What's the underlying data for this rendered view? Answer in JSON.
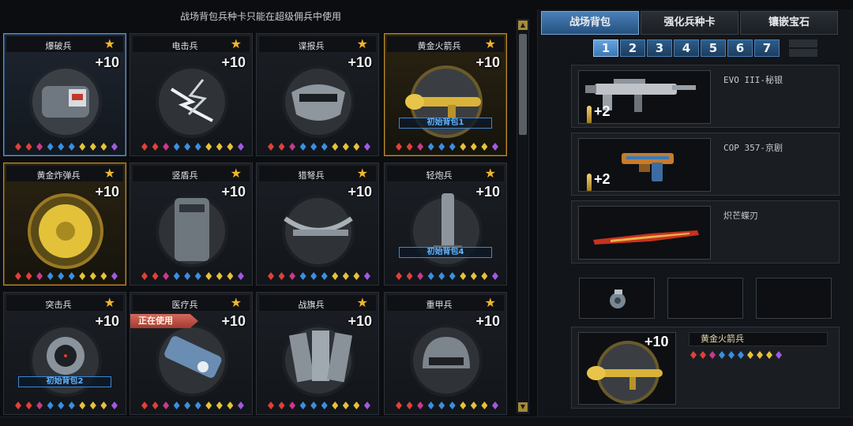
{
  "notice": "战场背包兵种卡只能在超级佣兵中使用",
  "colors": {
    "gold": "#f2b62e",
    "blue_badge": "#5fb2ff",
    "active_tab": "#4a7fb8",
    "inuse_red": "#c24a3c"
  },
  "gem_colors": [
    "#e0403a",
    "#e0403a",
    "#c83a8a",
    "#3a8fe0",
    "#3a8fe0",
    "#3a8fe0",
    "#e6c23a",
    "#e6c23a",
    "#e6c23a",
    "#a05ae0"
  ],
  "cards": [
    {
      "name": "爆破兵",
      "plus": "+10",
      "icon": "explosive-pack-icon",
      "state": "selected",
      "badge": "",
      "inuse": ""
    },
    {
      "name": "电击兵",
      "plus": "+10",
      "icon": "lightning-icon",
      "state": "",
      "badge": "",
      "inuse": ""
    },
    {
      "name": "谍报兵",
      "plus": "+10",
      "icon": "spy-mask-icon",
      "state": "",
      "badge": "",
      "inuse": ""
    },
    {
      "name": "黄金火箭兵",
      "plus": "+10",
      "icon": "rocket-launcher-icon",
      "state": "gold",
      "badge": "初始背包1",
      "inuse": ""
    },
    {
      "name": "黄金炸弹兵",
      "plus": "+10",
      "icon": "bomb-icon",
      "state": "gold",
      "badge": "",
      "inuse": ""
    },
    {
      "name": "竖盾兵",
      "plus": "+10",
      "icon": "riot-shield-icon",
      "state": "",
      "badge": "",
      "inuse": ""
    },
    {
      "name": "猎弩兵",
      "plus": "+10",
      "icon": "crossbow-icon",
      "state": "",
      "badge": "",
      "inuse": ""
    },
    {
      "name": "轻炮兵",
      "plus": "+10",
      "icon": "mortar-icon",
      "state": "",
      "badge": "初始背包4",
      "inuse": ""
    },
    {
      "name": "突击兵",
      "plus": "+10",
      "icon": "scope-icon",
      "state": "",
      "badge": "初始背包2",
      "inuse": ""
    },
    {
      "name": "医疗兵",
      "plus": "+10",
      "icon": "medkit-icon",
      "state": "",
      "badge": "",
      "inuse": "正在使用"
    },
    {
      "name": "战旗兵",
      "plus": "+10",
      "icon": "banner-icon",
      "state": "",
      "badge": "",
      "inuse": ""
    },
    {
      "name": "重甲兵",
      "plus": "+10",
      "icon": "helmet-icon",
      "state": "",
      "badge": "",
      "inuse": ""
    }
  ],
  "tabs": [
    {
      "label": "战场背包",
      "active": true
    },
    {
      "label": "强化兵种卡",
      "active": false
    },
    {
      "label": "镶嵌宝石",
      "active": false
    }
  ],
  "pages": [
    "1",
    "2",
    "3",
    "4",
    "5",
    "6",
    "7"
  ],
  "active_page": "1",
  "loadout": [
    {
      "name": "EVO III-秘银",
      "plus": "+2",
      "icon": "smg-icon"
    },
    {
      "name": "COP 357-京剧",
      "plus": "+2",
      "icon": "pistol-icon"
    },
    {
      "name": "炽芒蝶刃",
      "plus": "",
      "icon": "knife-icon"
    }
  ],
  "grenade_icon": "grenade-icon",
  "active_card": {
    "name": "黄金火箭兵",
    "plus": "+10",
    "icon": "rocket-launcher-icon"
  }
}
